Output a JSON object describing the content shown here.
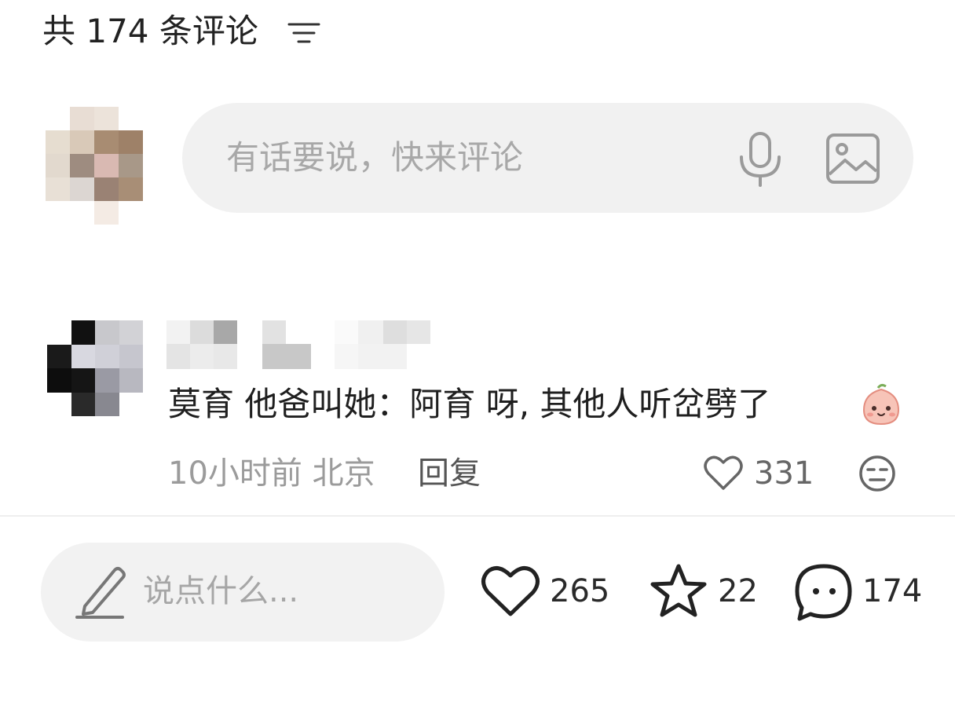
{
  "header": {
    "comment_count_title": "共 174 条评论",
    "sort_icon": "sort-lines-icon"
  },
  "composer": {
    "placeholder": "有话要说，快来评论",
    "mic_icon": "microphone-icon",
    "image_icon": "image-icon"
  },
  "comments": [
    {
      "text": "莫育 他爸叫她：阿育 呀, 其他人听岔劈了",
      "emoji": "smiling-peach-emoji",
      "time": "10小时前",
      "location": "北京",
      "reply_label": "回复",
      "likes": "331"
    }
  ],
  "bottom_bar": {
    "placeholder": "说点什么...",
    "like_count": "265",
    "star_count": "22",
    "comment_count": "174"
  },
  "colors": {
    "placeholder": "#a8a8a8",
    "meta": "#9b9b9b",
    "input_bg": "#f1f1f1"
  }
}
